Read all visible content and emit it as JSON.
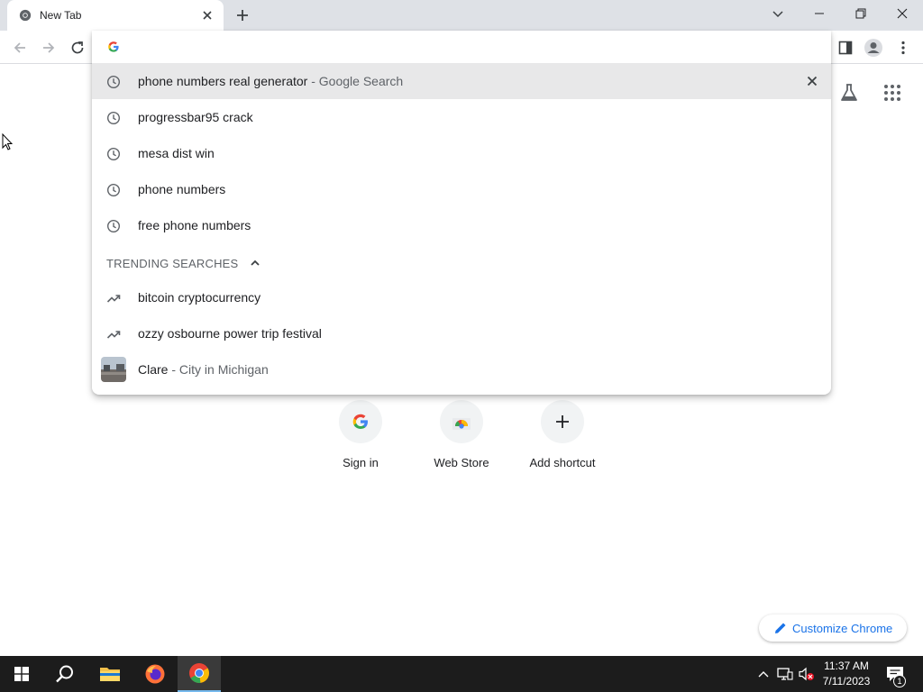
{
  "tab": {
    "title": "New Tab"
  },
  "omnibox": {
    "value": "",
    "placeholder": ""
  },
  "suggestions": [
    {
      "text": "phone numbers real generator",
      "suffix": " - Google Search"
    },
    {
      "text": "progressbar95 crack"
    },
    {
      "text": "mesa dist win"
    },
    {
      "text": "phone numbers"
    },
    {
      "text": "free phone numbers"
    }
  ],
  "trending": {
    "header": "TRENDING SEARCHES",
    "items": [
      {
        "text": "bitcoin cryptocurrency"
      },
      {
        "text": "ozzy osbourne power trip festival"
      }
    ]
  },
  "entity": {
    "text": "Clare",
    "suffix": " - City in Michigan"
  },
  "shortcuts": [
    {
      "label": "Sign in"
    },
    {
      "label": "Web Store"
    },
    {
      "label": "Add shortcut"
    }
  ],
  "customize": {
    "label": "Customize Chrome"
  },
  "clock": {
    "time": "11:37 AM",
    "date": "7/11/2023"
  },
  "notifications": {
    "count": "1"
  },
  "colors": {
    "accent": "#1a73e8",
    "tabstrip": "#dee1e6",
    "taskbar": "#1c1c1c"
  }
}
